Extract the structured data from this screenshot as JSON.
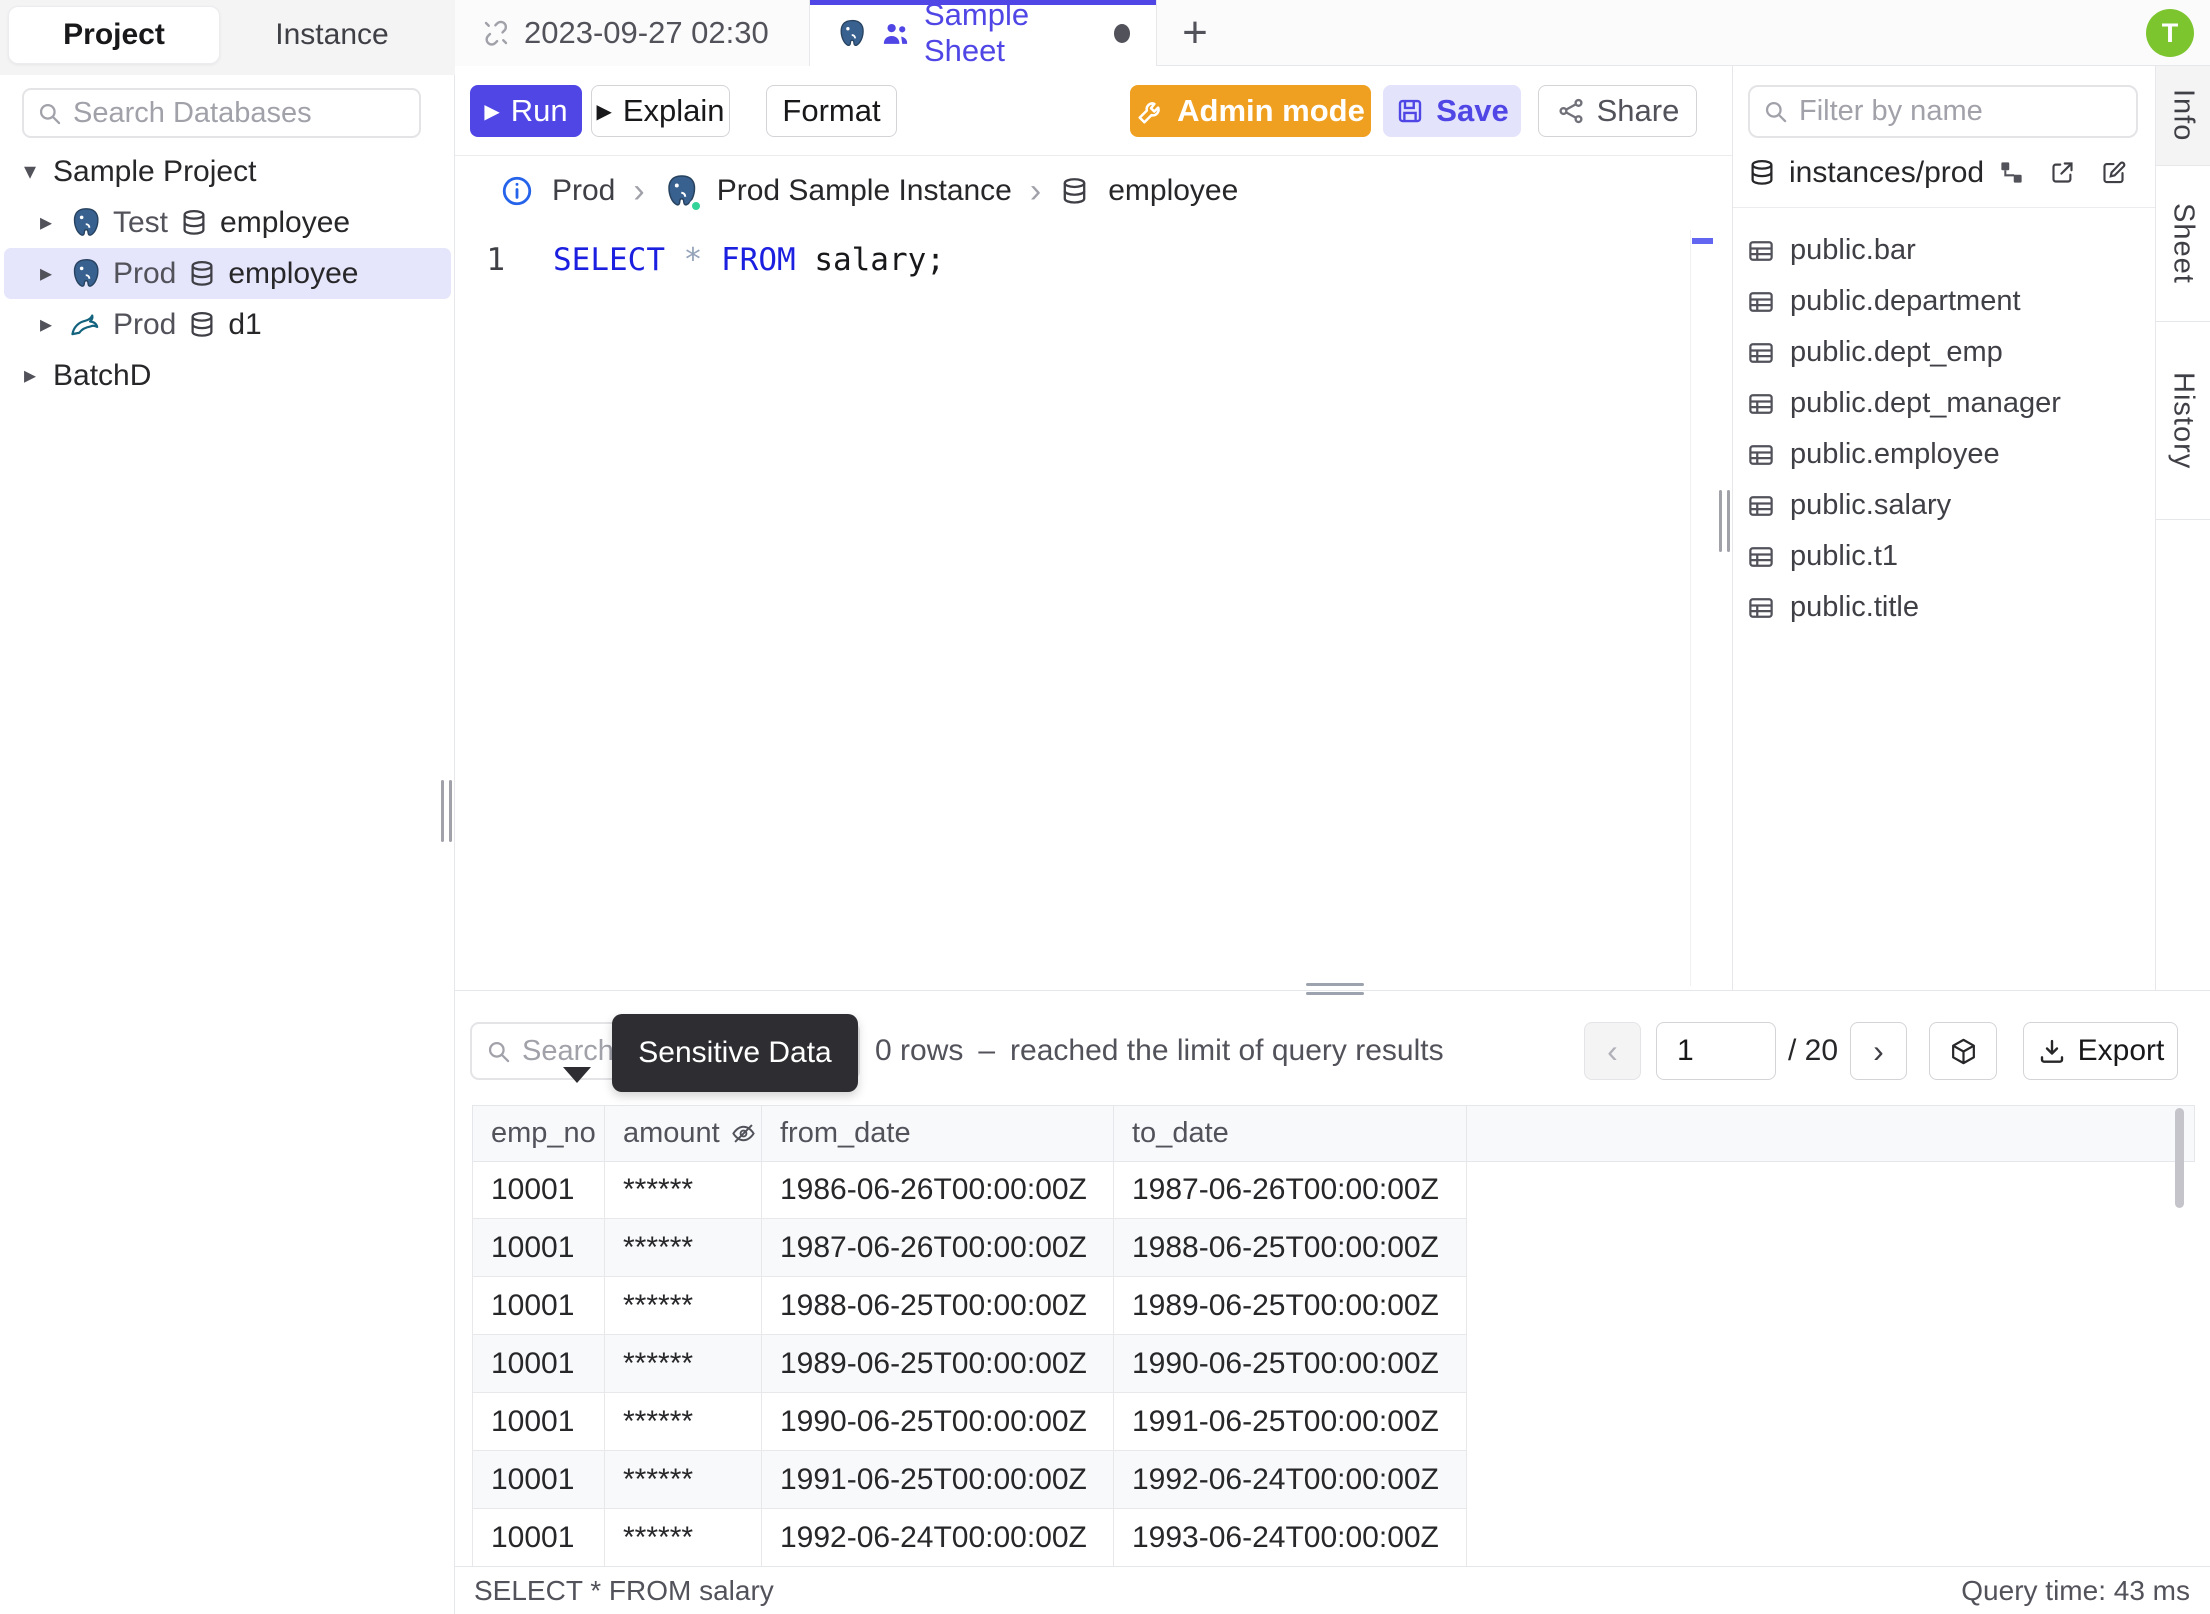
{
  "app": {
    "avatar_initial": "T"
  },
  "colors": {
    "accent": "#4f46e5",
    "admin_orange": "#f0a020",
    "keyword_blue": "#1b1fe0",
    "avatar_green": "#7dc52f",
    "status_green": "#34d399",
    "selected_row": "#e5e5fb",
    "tooltip_bg": "#2e2e32"
  },
  "sidebar": {
    "tabs": [
      {
        "label": "Project"
      },
      {
        "label": "Instance"
      }
    ],
    "search_placeholder": "Search Databases",
    "tree": [
      {
        "label": "Sample Project"
      },
      {
        "engine": "postgres",
        "env": "Test",
        "database": "employee"
      },
      {
        "engine": "postgres",
        "env": "Prod",
        "database": "employee",
        "selected": true
      },
      {
        "engine": "mysql",
        "env": "Prod",
        "database": "d1"
      },
      {
        "label": "BatchD"
      }
    ]
  },
  "tabbar": {
    "tab1_title": "2023-09-27 02:30",
    "tab2_title": "Sample Sheet",
    "new_tab_label": "+"
  },
  "toolbar": {
    "run_label": "Run",
    "explain_label": "Explain",
    "format_label": "Format",
    "admin_label": "Admin mode",
    "save_label": "Save",
    "share_label": "Share"
  },
  "breadcrumb": {
    "env": "Prod",
    "instance": "Prod Sample Instance",
    "database": "employee",
    "sep": "›"
  },
  "editor": {
    "line_number": "1",
    "kw1": "SELECT",
    "star": "*",
    "kw2": "FROM",
    "rest": " salary;"
  },
  "schema_panel": {
    "filter_placeholder": "Filter by name",
    "scope": "instances/prod",
    "tables": [
      "public.bar",
      "public.department",
      "public.dept_emp",
      "public.dept_manager",
      "public.employee",
      "public.salary",
      "public.t1",
      "public.title"
    ]
  },
  "side_tabs": [
    {
      "label": "Info",
      "active": true
    },
    {
      "label": "Sheet"
    },
    {
      "label": "History"
    }
  ],
  "results": {
    "search_placeholder": "Search",
    "tooltip": "Sensitive Data",
    "summary_rows": "0 rows",
    "summary_dash": "–",
    "summary_note": "reached the limit of query results",
    "page": {
      "current": "1",
      "total": "/ 20"
    },
    "export_label": "Export",
    "table": {
      "columns": [
        "emp_no",
        "amount",
        "from_date",
        "to_date"
      ],
      "masked_column": "amount",
      "rows": [
        [
          "10001",
          "******",
          "1986-06-26T00:00:00Z",
          "1987-06-26T00:00:00Z"
        ],
        [
          "10001",
          "******",
          "1987-06-26T00:00:00Z",
          "1988-06-25T00:00:00Z"
        ],
        [
          "10001",
          "******",
          "1988-06-25T00:00:00Z",
          "1989-06-25T00:00:00Z"
        ],
        [
          "10001",
          "******",
          "1989-06-25T00:00:00Z",
          "1990-06-25T00:00:00Z"
        ],
        [
          "10001",
          "******",
          "1990-06-25T00:00:00Z",
          "1991-06-25T00:00:00Z"
        ],
        [
          "10001",
          "******",
          "1991-06-25T00:00:00Z",
          "1992-06-24T00:00:00Z"
        ],
        [
          "10001",
          "******",
          "1992-06-24T00:00:00Z",
          "1993-06-24T00:00:00Z"
        ]
      ]
    },
    "status_left": "SELECT * FROM salary",
    "status_right": "Query time: 43 ms"
  }
}
